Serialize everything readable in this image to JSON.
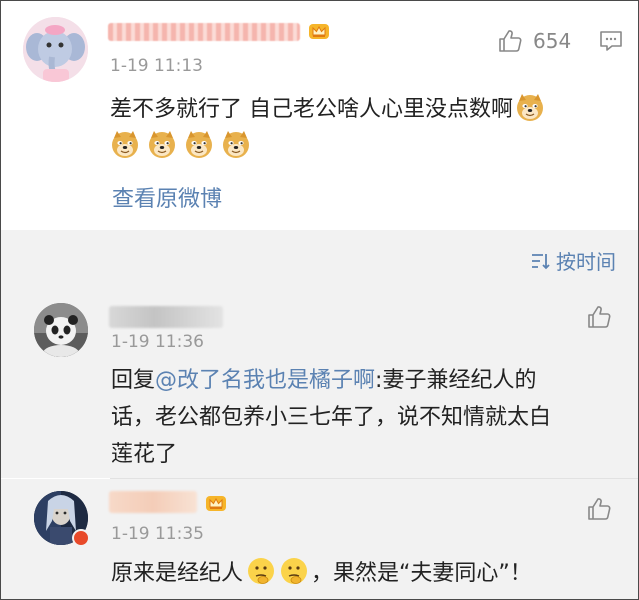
{
  "main_comment": {
    "likes": "654",
    "time": "1-19 11:13",
    "text": "差不多就行了 自己老公啥人心里没点数啊",
    "view_original": "查看原微博"
  },
  "sort": {
    "label": "按时间"
  },
  "replies": [
    {
      "time": "1-19 11:36",
      "prefix": "回复",
      "mention": "@改了名我也是橘子啊",
      "line1_rest": ":妻子兼经纪人的",
      "line2": "话，老公都包养小三七年了，说不知情就太白",
      "line3": "莲花了"
    },
    {
      "time": "1-19 11:35",
      "text_a": "原来是经纪人",
      "text_b": "，果然是“夫妻同心”！"
    }
  ],
  "icons": {
    "doge": "doge-emoji",
    "thinking": "thinking-emoji",
    "like": "thumbs-up-icon",
    "comment": "comment-icon",
    "crown": "vip-crown-icon",
    "sort": "sort-icon"
  },
  "colors": {
    "link": "#5b82b2",
    "time": "#999999",
    "reply_bg": "#f2f2f2"
  }
}
